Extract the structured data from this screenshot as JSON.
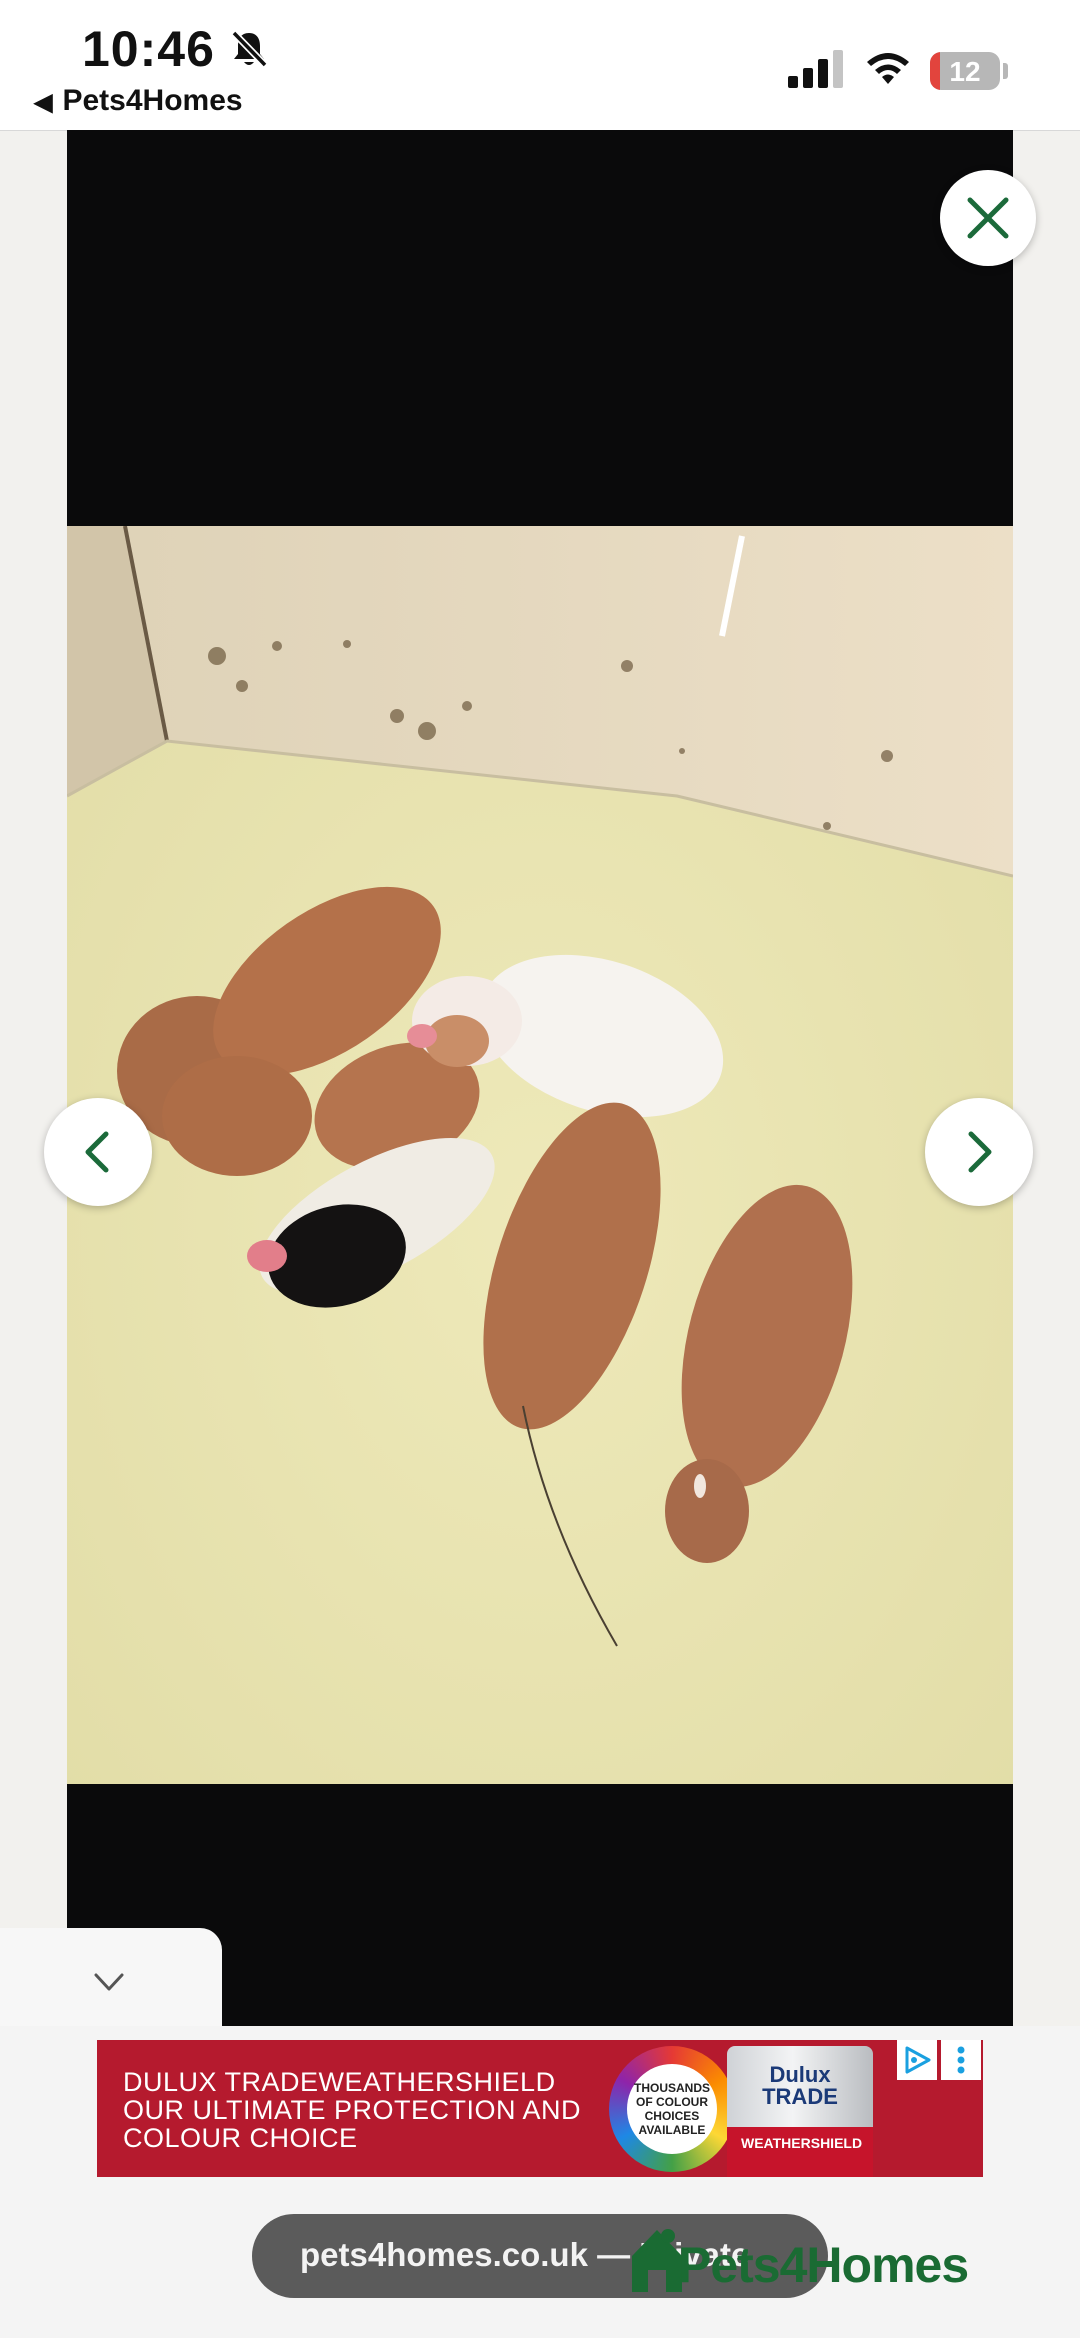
{
  "status_bar": {
    "time": "10:46",
    "back_label": "Pets4Homes",
    "battery_level": "12",
    "icons": [
      "bell-slash-icon",
      "cellular-signal-icon",
      "wifi-icon",
      "battery-icon"
    ]
  },
  "viewer": {
    "photo_description_icon": "puppies-photo",
    "buttons": [
      "close-icon",
      "chevron-left-icon",
      "chevron-right-icon"
    ],
    "collapse_icon": "chevron-down-icon"
  },
  "ad": {
    "lines": [
      "DULUX TRADEWEATHERSHIELD",
      "OUR ULTIMATE PROTECTION AND",
      "COLOUR CHOICE"
    ],
    "badge_lines": [
      "THOUSANDS",
      "OF COLOUR",
      "CHOICES",
      "AVAILABLE"
    ],
    "can_brand": "Dulux TRADE",
    "can_band": "WEATHERSHIELD",
    "colors": {
      "banner": "#b51a2e"
    }
  },
  "address_bar": {
    "url": "pets4homes.co.uk — Private"
  },
  "brand": {
    "name": "Pets4Homes",
    "color": "#1a6b33"
  }
}
